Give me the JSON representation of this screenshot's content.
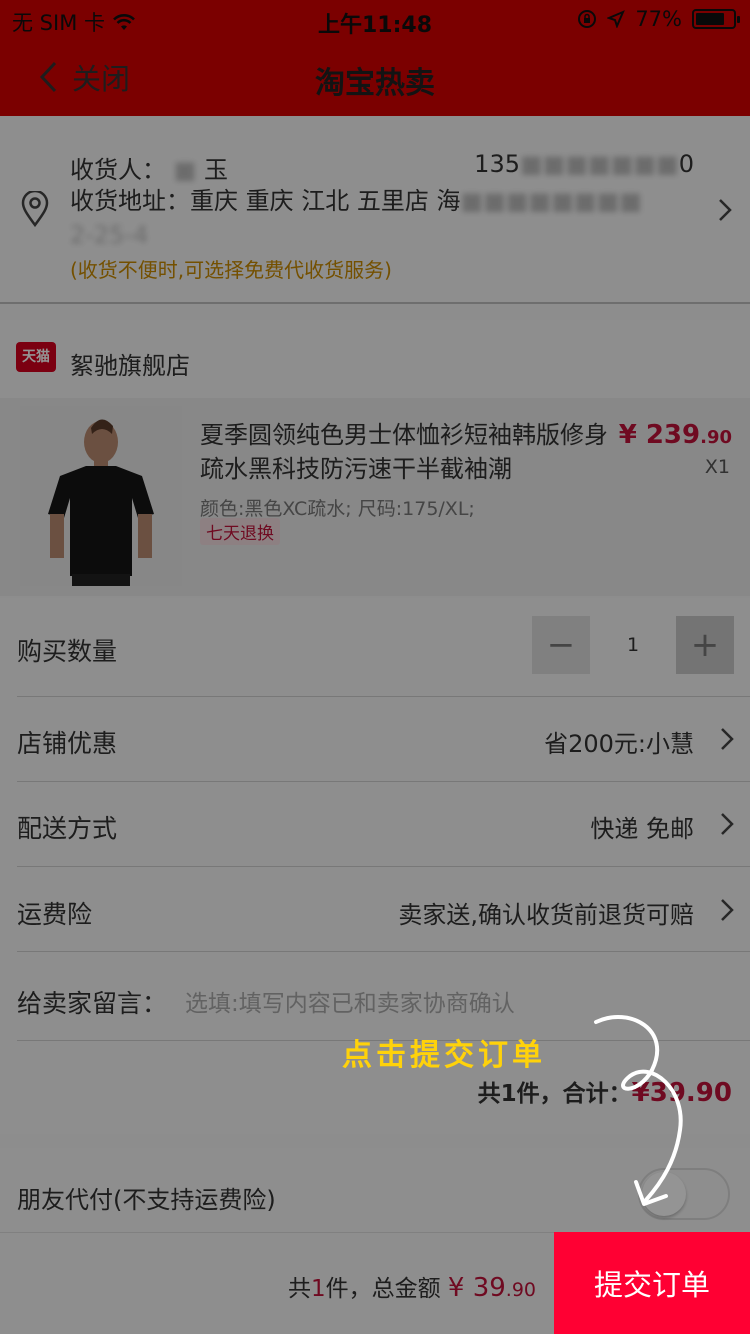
{
  "status_bar": {
    "carrier": "无 SIM 卡",
    "time": "上午11:48",
    "battery": "77%",
    "battery_level": 0.77
  },
  "nav": {
    "back_label": "关闭",
    "title": "淘宝热卖"
  },
  "address": {
    "receiver_label": "收货人：",
    "receiver_name": "玉",
    "phone": "135",
    "phone_tail": "0",
    "address_label": "收货地址：",
    "address_text": "重庆 重庆 江北 五里店 海",
    "address_line2": "2-25-4",
    "hint": "(收货不便时,可选择免费代收货服务)"
  },
  "shop": {
    "badge": "天猫",
    "name": "絮驰旗舰店"
  },
  "product": {
    "title": "夏季圆领纯色男士体恤衫短袖韩版修身疏水黑科技防污速干半截袖潮",
    "attrs": "颜色:黑色XC疏水; 尺码:175/XL;",
    "tag": "七天退换",
    "price_main": "¥ 239",
    "price_decimal": ".90",
    "quantity": "X1"
  },
  "rows": {
    "quantity_label": "购买数量",
    "quantity_minus": "−",
    "quantity_value": "1",
    "quantity_plus": "+",
    "discount_label": "店铺优惠",
    "discount_value": "省200元:小慧",
    "shipping_label": "配送方式",
    "shipping_value": "快递 免邮",
    "insurance_label": "运费险",
    "insurance_value": "卖家送,确认收货前退货可赔",
    "message_label": "给卖家留言：",
    "message_placeholder": "选填:填写内容已和卖家协商确认"
  },
  "summary": {
    "prefix": "共1件，合计：",
    "amount": "¥39.90"
  },
  "friends": {
    "label": "朋友代付(不支持运费险)"
  },
  "bottom": {
    "total_prefix": "共",
    "total_count": "1",
    "total_suffix": "件，总金额",
    "amount_main": "¥ 39",
    "amount_decimal": ".90",
    "submit_label": "提交订单"
  },
  "guide": {
    "callout": "点击提交订单"
  }
}
